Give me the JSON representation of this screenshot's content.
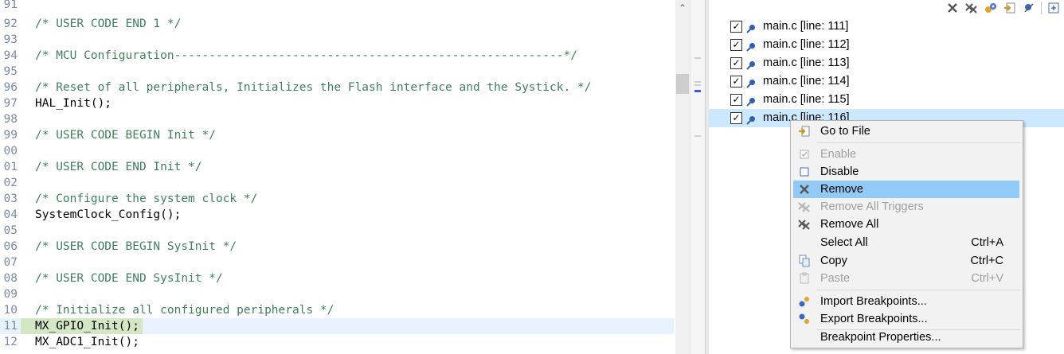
{
  "editor": {
    "lines": [
      {
        "num": "91",
        "text": ""
      },
      {
        "num": "92",
        "text": "/* USER CODE END 1 */"
      },
      {
        "num": "93",
        "text": ""
      },
      {
        "num": "94",
        "text": "/* MCU Configuration--------------------------------------------------------*/"
      },
      {
        "num": "95",
        "text": ""
      },
      {
        "num": "96",
        "text": "/* Reset of all peripherals, Initializes the Flash interface and the Systick. */"
      },
      {
        "num": "97",
        "text": "HAL_Init();"
      },
      {
        "num": "98",
        "text": ""
      },
      {
        "num": "99",
        "text": "/* USER CODE BEGIN Init */"
      },
      {
        "num": "00",
        "text": ""
      },
      {
        "num": "01",
        "text": "/* USER CODE END Init */"
      },
      {
        "num": "02",
        "text": ""
      },
      {
        "num": "03",
        "text": "/* Configure the system clock */"
      },
      {
        "num": "04",
        "text": "SystemClock_Config();"
      },
      {
        "num": "05",
        "text": ""
      },
      {
        "num": "06",
        "text": "/* USER CODE BEGIN SysInit */"
      },
      {
        "num": "07",
        "text": ""
      },
      {
        "num": "08",
        "text": "/* USER CODE END SysInit */"
      },
      {
        "num": "09",
        "text": ""
      },
      {
        "num": "10",
        "text": "/* Initialize all configured peripherals */"
      },
      {
        "num": "11",
        "text": "MX_GPIO_Init();"
      },
      {
        "num": "12",
        "text": "MX_ADC1_Init();"
      }
    ],
    "current_line": "11"
  },
  "breakpoints": {
    "toolbar": [
      "remove-icon",
      "remove-all-icon",
      "link-icon",
      "goto-file-icon",
      "skip-icon",
      "expand-icon"
    ],
    "items": [
      {
        "label": "main.c [line: 111]",
        "checked": true
      },
      {
        "label": "main.c [line: 112]",
        "checked": true
      },
      {
        "label": "main.c [line: 113]",
        "checked": true
      },
      {
        "label": "main.c [line: 114]",
        "checked": true
      },
      {
        "label": "main.c [line: 115]",
        "checked": true
      },
      {
        "label": "main.c [line: 116]",
        "checked": true
      }
    ]
  },
  "context_menu": {
    "goto_file": "Go to File",
    "enable": "Enable",
    "disable": "Disable",
    "remove": "Remove",
    "remove_all_triggers": "Remove All Triggers",
    "remove_all": "Remove All",
    "select_all": "Select All",
    "select_all_shortcut": "Ctrl+A",
    "copy": "Copy",
    "copy_shortcut": "Ctrl+C",
    "paste": "Paste",
    "paste_shortcut": "Ctrl+V",
    "import": "Import Breakpoints...",
    "export": "Export Breakpoints...",
    "properties": "Breakpoint Properties..."
  },
  "colors": {
    "comment": "#3f7f5f",
    "menu_highlight": "#91c9f7",
    "selected_row": "#cce8ff",
    "current_line": "#e8f2fe"
  }
}
